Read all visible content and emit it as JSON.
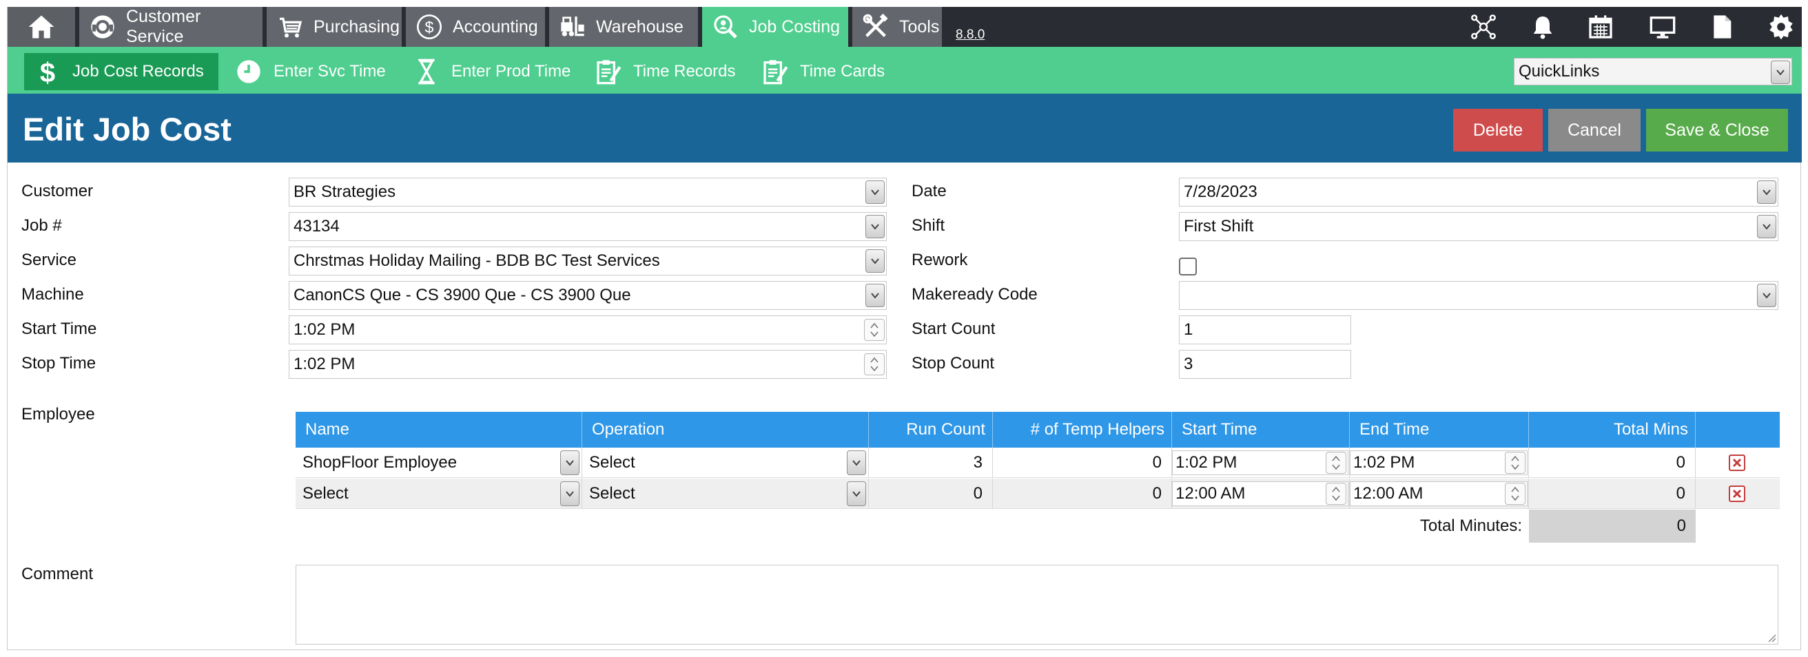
{
  "nav": {
    "tabs": [
      {
        "label": "Customer Service",
        "icon": "headset-icon"
      },
      {
        "label": "Purchasing",
        "icon": "cart-icon"
      },
      {
        "label": "Accounting",
        "icon": "dollar-circle-icon"
      },
      {
        "label": "Warehouse",
        "icon": "forklift-icon"
      },
      {
        "label": "Job Costing",
        "icon": "search-person-icon"
      },
      {
        "label": "Tools",
        "icon": "tools-icon"
      }
    ],
    "version": "8.8.0",
    "right_icons": [
      "network-icon",
      "bell-icon",
      "calendar-icon",
      "monitor-icon",
      "document-icon",
      "gear-icon"
    ]
  },
  "subnav": {
    "items": [
      {
        "label": "Job Cost Records",
        "icon": "dollar-icon"
      },
      {
        "label": "Enter Svc Time",
        "icon": "clock-icon"
      },
      {
        "label": "Enter Prod Time",
        "icon": "hourglass-icon"
      },
      {
        "label": "Time Records",
        "icon": "clipboard-edit-icon"
      },
      {
        "label": "Time Cards",
        "icon": "clipboard-edit-icon"
      }
    ],
    "quicklinks": "QuickLinks"
  },
  "page": {
    "title": "Edit Job Cost",
    "delete_label": "Delete",
    "cancel_label": "Cancel",
    "save_label": "Save & Close"
  },
  "form": {
    "customer_label": "Customer",
    "customer": "BR Strategies",
    "job_label": "Job #",
    "job": "43134",
    "service_label": "Service",
    "service": "Chrstmas Holiday Mailing - BDB BC Test Services",
    "machine_label": "Machine",
    "machine": "CanonCS Que - CS 3900 Que - CS 3900 Que",
    "start_time_label": "Start Time",
    "start_time": "1:02 PM",
    "stop_time_label": "Stop Time",
    "stop_time": "1:02 PM",
    "date_label": "Date",
    "date": "7/28/2023",
    "shift_label": "Shift",
    "shift": "First Shift",
    "rework_label": "Rework",
    "rework_checked": false,
    "makeready_label": "Makeready Code",
    "makeready": "",
    "start_count_label": "Start Count",
    "start_count": "1",
    "stop_count_label": "Stop Count",
    "stop_count": "3",
    "employee_label": "Employee",
    "comment_label": "Comment",
    "comment": ""
  },
  "grid": {
    "headers": {
      "name": "Name",
      "operation": "Operation",
      "run_count": "Run Count",
      "temp_helpers": "# of Temp Helpers",
      "start_time": "Start Time",
      "end_time": "End Time",
      "total_mins": "Total Mins"
    },
    "rows": [
      {
        "name": "ShopFloor Employee",
        "operation": "Select",
        "run_count": "3",
        "temp_helpers": "0",
        "start_time": "1:02 PM",
        "end_time": "1:02 PM",
        "total_mins": "0"
      },
      {
        "name": "Select",
        "operation": "Select",
        "run_count": "0",
        "temp_helpers": "0",
        "start_time": "12:00 AM",
        "end_time": "12:00 AM",
        "total_mins": "0"
      }
    ],
    "total_label": "Total Minutes:",
    "total_value": "0"
  },
  "colors": {
    "topnav": "#2a2c33",
    "accent_green": "#4fce8f",
    "title_blue": "#196598",
    "delete": "#cf4c4c",
    "cancel": "#8a8a8a",
    "save": "#58ab4a",
    "grid_header": "#2f97e7"
  }
}
